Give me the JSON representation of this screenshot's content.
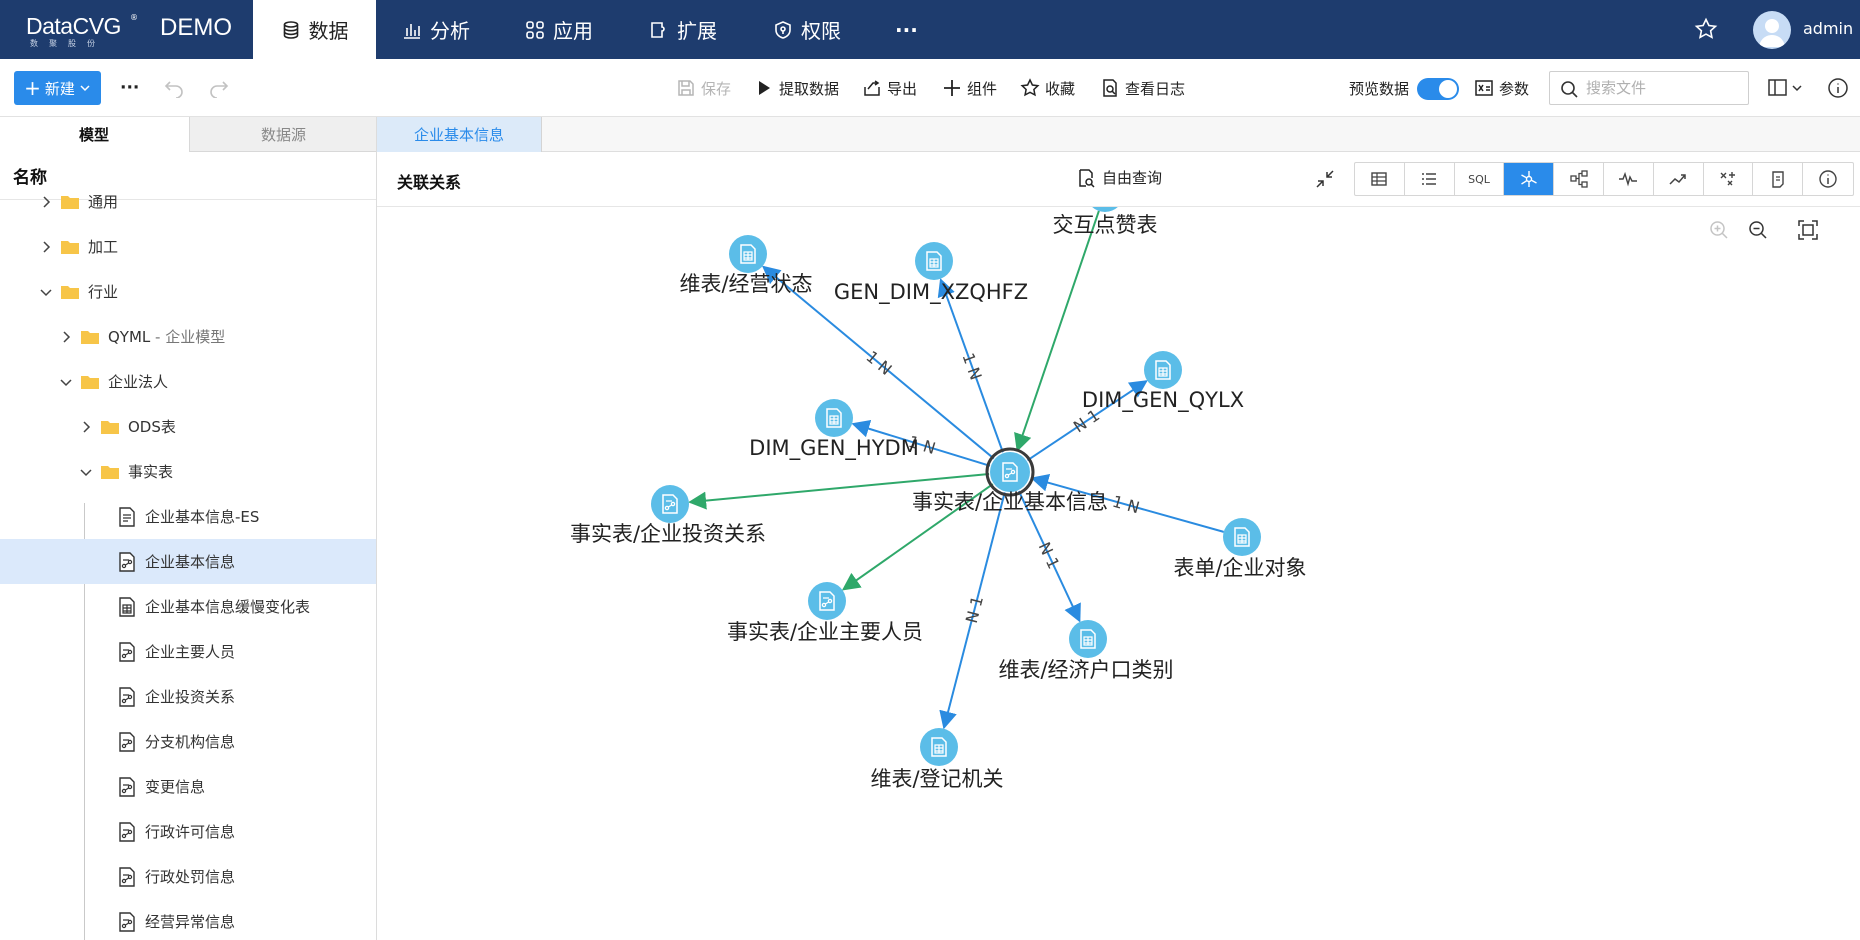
{
  "app": {
    "logo_main": "DataCVG",
    "logo_reg": "®",
    "logo_sub": "数聚股份",
    "env": "DEMO"
  },
  "nav": [
    {
      "label": "数据",
      "icon": "database-icon",
      "active": true
    },
    {
      "label": "分析",
      "icon": "bar-chart-icon"
    },
    {
      "label": "应用",
      "icon": "grid-apps-icon"
    },
    {
      "label": "扩展",
      "icon": "puzzle-icon"
    },
    {
      "label": "权限",
      "icon": "shield-icon"
    },
    {
      "label": "···",
      "icon": "more-icon"
    }
  ],
  "user": {
    "name": "admin"
  },
  "toolbar": {
    "new_label": "新建",
    "more": "···",
    "save": "保存",
    "fetch": "提取数据",
    "export": "导出",
    "component": "组件",
    "favorite": "收藏",
    "log": "查看日志",
    "preview": "预览数据",
    "params": "参数",
    "search_placeholder": "搜索文件"
  },
  "left": {
    "tabs": [
      "模型",
      "数据源"
    ],
    "header": "名称",
    "tree": [
      {
        "label": "通用",
        "type": "folder",
        "depth": 0,
        "expanded": false
      },
      {
        "label": "加工",
        "type": "folder",
        "depth": 0,
        "expanded": false
      },
      {
        "label": "行业",
        "type": "folder",
        "depth": 0,
        "expanded": true
      },
      {
        "label": "QYML",
        "suffix": " - 企业模型",
        "type": "folder",
        "depth": 1,
        "expanded": false
      },
      {
        "label": "企业法人",
        "type": "folder",
        "depth": 1,
        "expanded": true
      },
      {
        "label": "ODS表",
        "type": "folder",
        "depth": 2,
        "expanded": false
      },
      {
        "label": "事实表",
        "type": "folder",
        "depth": 2,
        "expanded": true
      },
      {
        "label": "企业基本信息-ES",
        "type": "doc",
        "depth": 3
      },
      {
        "label": "企业基本信息",
        "type": "fact",
        "depth": 3,
        "selected": true
      },
      {
        "label": "企业基本信息缓慢变化表",
        "type": "table",
        "depth": 3
      },
      {
        "label": "企业主要人员",
        "type": "fact",
        "depth": 3
      },
      {
        "label": "企业投资关系",
        "type": "fact",
        "depth": 3
      },
      {
        "label": "分支机构信息",
        "type": "fact",
        "depth": 3
      },
      {
        "label": "变更信息",
        "type": "fact",
        "depth": 3
      },
      {
        "label": "行政许可信息",
        "type": "fact",
        "depth": 3
      },
      {
        "label": "行政处罚信息",
        "type": "fact",
        "depth": 3
      },
      {
        "label": "经营异常信息",
        "type": "fact",
        "depth": 3
      }
    ]
  },
  "doc_tab": "企业基本信息",
  "view": {
    "title": "关联关系",
    "free_query": "自由查询",
    "buttons": [
      {
        "name": "table-view",
        "label": ""
      },
      {
        "name": "list-view",
        "label": ""
      },
      {
        "name": "sql-view",
        "label": "SQL"
      },
      {
        "name": "relation-view",
        "label": "",
        "active": true
      },
      {
        "name": "lineage-view",
        "label": ""
      },
      {
        "name": "monitor-view",
        "label": ""
      },
      {
        "name": "trend-view",
        "label": ""
      },
      {
        "name": "transform-view",
        "label": ""
      },
      {
        "name": "script-view",
        "label": ""
      },
      {
        "name": "info-view",
        "label": ""
      }
    ]
  },
  "graph": {
    "colors": {
      "node": "#5bbde8",
      "center_ring": "#3a3a3a",
      "blue_edge": "#2a8be0",
      "green_edge": "#2fa86a"
    },
    "nodes": [
      {
        "id": "center",
        "label": "事实表/企业基本信息",
        "kind": "fact",
        "center": true
      },
      {
        "id": "n1",
        "label": "交互点赞表",
        "kind": "table"
      },
      {
        "id": "n2",
        "label": "维表/经营状态",
        "kind": "table"
      },
      {
        "id": "n3",
        "label": "GEN_DIM_XZQHFZ",
        "kind": "table"
      },
      {
        "id": "n4",
        "label": "DIM_GEN_QYLX",
        "kind": "table"
      },
      {
        "id": "n5",
        "label": "DIM_GEN_HYDM",
        "kind": "table"
      },
      {
        "id": "n6",
        "label": "事实表/企业投资关系",
        "kind": "fact"
      },
      {
        "id": "n7",
        "label": "表单/企业对象",
        "kind": "table"
      },
      {
        "id": "n8",
        "label": "事实表/企业主要人员",
        "kind": "fact"
      },
      {
        "id": "n9",
        "label": "维表/经济户口类别",
        "kind": "table"
      },
      {
        "id": "n10",
        "label": "维表/登记机关",
        "kind": "table"
      }
    ],
    "edges": [
      {
        "from": "n1",
        "to": "center",
        "color": "green",
        "label": ""
      },
      {
        "from": "center",
        "to": "n2",
        "color": "blue",
        "label": "1  N"
      },
      {
        "from": "center",
        "to": "n3",
        "color": "blue",
        "label": "1  N"
      },
      {
        "from": "center",
        "to": "n4",
        "color": "blue",
        "label": "N  1"
      },
      {
        "from": "center",
        "to": "n5",
        "color": "blue",
        "label": "1  N"
      },
      {
        "from": "center",
        "to": "n6",
        "color": "green",
        "label": ""
      },
      {
        "from": "n7",
        "to": "center",
        "color": "blue",
        "label": "1  N"
      },
      {
        "from": "center",
        "to": "n8",
        "color": "green",
        "label": ""
      },
      {
        "from": "center",
        "to": "n9",
        "color": "blue",
        "label": "N  1"
      },
      {
        "from": "center",
        "to": "n10",
        "color": "blue",
        "label": "N  1"
      }
    ]
  }
}
